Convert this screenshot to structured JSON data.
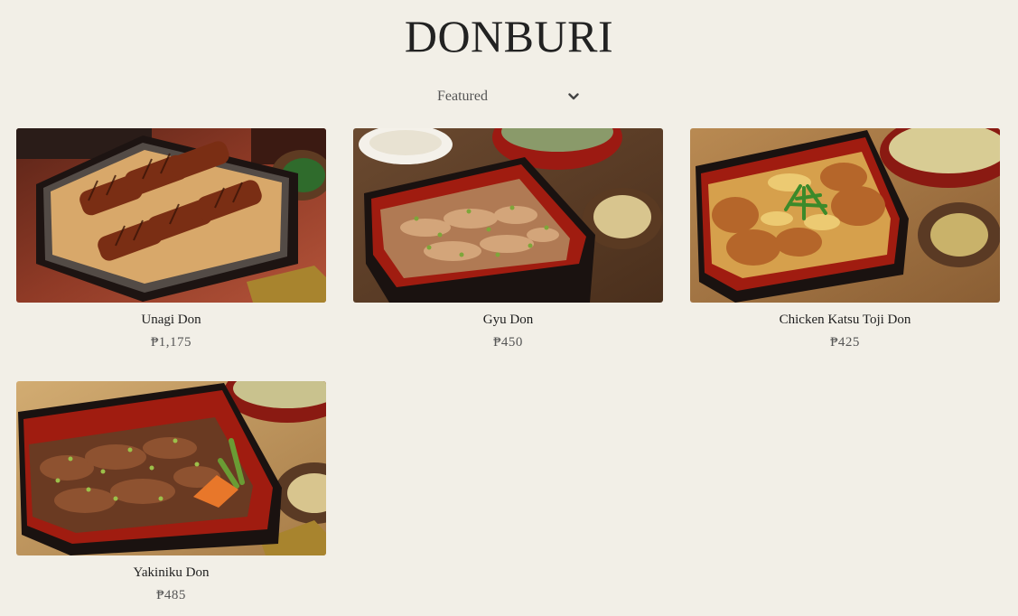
{
  "page": {
    "title": "DONBURI"
  },
  "sort": {
    "selected": "Featured",
    "icon": "chevron-down-icon"
  },
  "products": [
    {
      "name": "Unagi Don",
      "price": "₱1,175"
    },
    {
      "name": "Gyu Don",
      "price": "₱450"
    },
    {
      "name": "Chicken Katsu Toji Don",
      "price": "₱425"
    },
    {
      "name": "Yakiniku Don",
      "price": "₱485"
    }
  ],
  "colors": {
    "background": "#f2efe7",
    "text": "#222222",
    "price": "#555555",
    "box_red": "#a61c10",
    "box_black": "#1d1412"
  }
}
